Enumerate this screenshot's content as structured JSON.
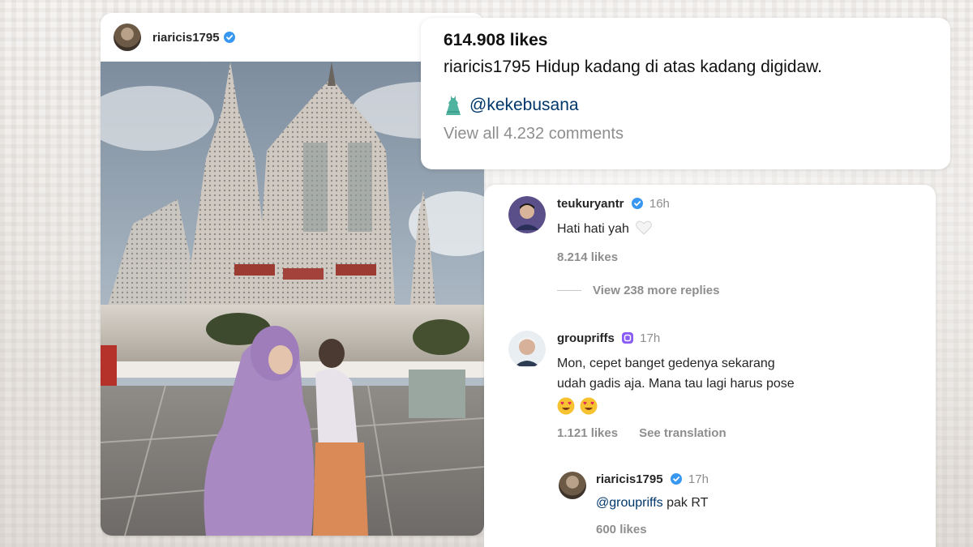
{
  "post": {
    "username": "riaricis1795",
    "avatar_icon": "profile-avatar-icon",
    "verified_icon": "verified-badge-icon",
    "photo": "temple-photo"
  },
  "caption": {
    "likes": "614.908 likes",
    "username": "riaricis1795",
    "text": " Hidup kadang di atas kadang digidaw.",
    "tag_icon": "dress-icon",
    "tag": "@kekebusana",
    "view_all": "View all 4.232 comments"
  },
  "comments": [
    {
      "username": "teukuryantr",
      "time": "16h",
      "badge": "verified-badge-icon",
      "text": "Hati hati yah",
      "text_icon": "white-heart-icon",
      "likes": "8.214 likes",
      "view_replies": "View 238 more replies"
    },
    {
      "username": "groupriffs",
      "time": "17h",
      "badge": "purple-badge-icon",
      "text_line1": "Mon, cepet banget gedenya sekarang",
      "text_line2": "udah gadis aja. Mana tau lagi harus pose",
      "emoji": "heart-eyes-emoji-icon",
      "likes": "1.121 likes",
      "translation": "See translation"
    },
    {
      "username": "riaricis1795",
      "time": "17h",
      "badge": "verified-badge-icon",
      "mention": "@groupriffs",
      "text": " pak RT",
      "likes": "600 likes"
    }
  ],
  "colors": {
    "verified": "#3897f0",
    "link": "#00376b",
    "muted": "#8e8e8e",
    "purple_badge": "#8a5cf6"
  }
}
